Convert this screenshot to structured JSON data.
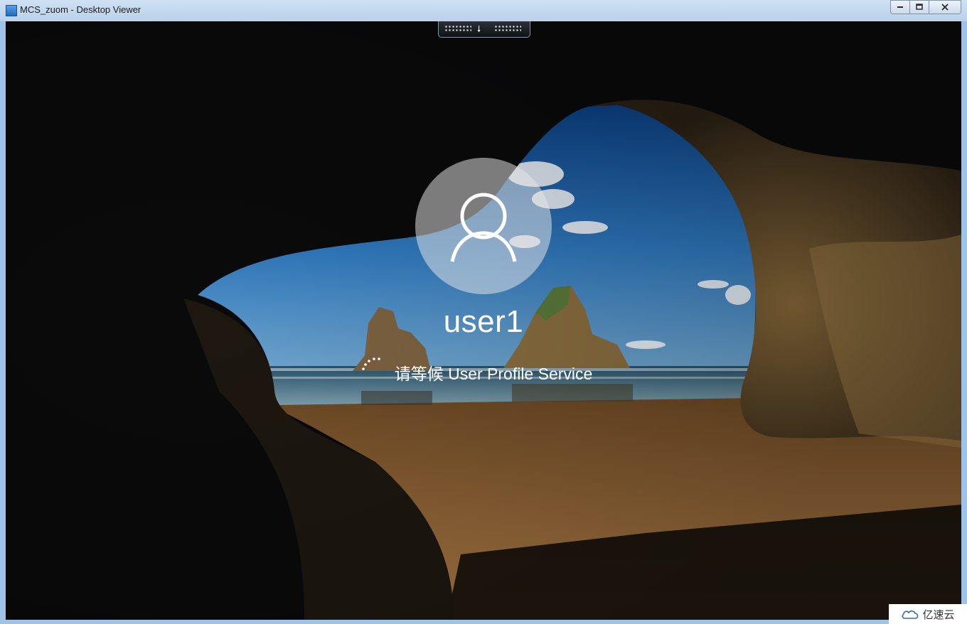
{
  "window": {
    "title": "MCS_zuom - Desktop Viewer",
    "minimize_label": "▭",
    "restore_label": "⧉",
    "close_label": "✕"
  },
  "lock_screen": {
    "username": "user1",
    "status_text": "请等候 User Profile Service"
  },
  "icons": {
    "app": "desktop-viewer-icon",
    "user": "user-avatar-icon",
    "spinner": "loading-spinner-icon",
    "connection_bar": "down-arrow-icon"
  },
  "watermark": {
    "text": "亿速云"
  },
  "colors": {
    "titlebar": "#c4d9ef",
    "avatar_circle": "#e6e6e6",
    "text": "#ffffff"
  }
}
